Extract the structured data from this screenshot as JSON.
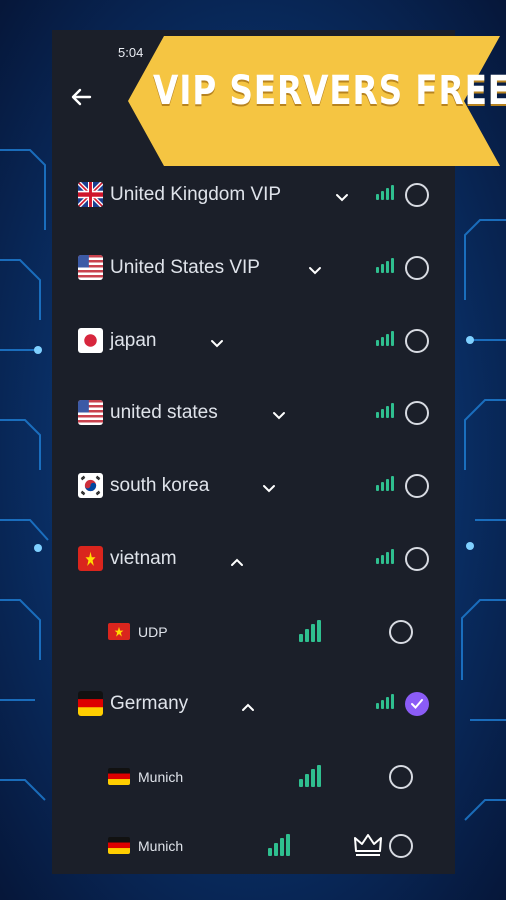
{
  "status": {
    "time": "5:04"
  },
  "banner": {
    "text": "VIP SERVERS FREE",
    "color": "#f5c542"
  },
  "colors": {
    "accent": "#8b5cf6",
    "signal": "#2fbf8f",
    "panel": "#1b1f29"
  },
  "servers": [
    {
      "name": "United Kingdom VIP",
      "flag": "uk-flag",
      "expanded": false,
      "signal_bars": 4,
      "selected": false
    },
    {
      "name": "United States VIP",
      "flag": "us-flag",
      "expanded": false,
      "signal_bars": 3,
      "selected": false
    },
    {
      "name": "japan",
      "flag": "japan-flag",
      "expanded": false,
      "signal_bars": 2,
      "selected": false
    },
    {
      "name": "united states",
      "flag": "us-flag",
      "expanded": false,
      "signal_bars": 2,
      "selected": false
    },
    {
      "name": "south korea",
      "flag": "korea-flag",
      "expanded": false,
      "signal_bars": 2,
      "selected": false
    },
    {
      "name": "vietnam",
      "flag": "vietnam-flag",
      "expanded": true,
      "signal_bars": 2,
      "selected": false,
      "children": [
        {
          "name": "UDP",
          "flag": "vietnam-flag",
          "signal_bars": 3,
          "selected": false
        }
      ]
    },
    {
      "name": "Germany",
      "flag": "germany-flag",
      "expanded": true,
      "signal_bars": 2,
      "selected": true,
      "children": [
        {
          "name": "Munich",
          "flag": "germany-flag",
          "signal_bars": 3,
          "selected": false,
          "premium": false
        },
        {
          "name": "Munich",
          "flag": "germany-flag",
          "signal_bars": 3,
          "selected": false,
          "premium": true,
          "badge_icon": "crown-icon"
        }
      ]
    }
  ]
}
